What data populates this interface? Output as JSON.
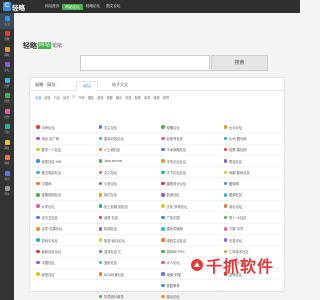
{
  "topbar": {
    "logo_mark": "C",
    "logo_text": "轻略",
    "nav": [
      {
        "label": "网址首页",
        "active": false
      },
      {
        "label": "网站论坛",
        "active": true
      },
      {
        "label": "轻略论坛",
        "active": false
      },
      {
        "label": "图文论坛",
        "active": false
      }
    ]
  },
  "sidebar": {
    "items": [
      {
        "label": "主页",
        "color": "#3a8ee6"
      },
      {
        "label": "轻略",
        "color": "#e23b3b"
      },
      {
        "label": "网站",
        "color": "#e29a25"
      },
      {
        "label": "论坛",
        "color": "#8b5cd6"
      },
      {
        "label": "社区",
        "color": "#3bb3e2"
      },
      {
        "label": "搜索",
        "color": "#4caf50"
      },
      {
        "label": "社交",
        "color": "#e25fa0"
      },
      {
        "label": "导航",
        "color": "#25b39a"
      },
      {
        "label": "网址",
        "color": "#e2c625"
      },
      {
        "label": "博客",
        "color": "#ee7a2d"
      },
      {
        "label": "资讯",
        "color": "#5a7ae2"
      },
      {
        "label": "登录",
        "color": "#9a9a9a"
      }
    ]
  },
  "brand": {
    "main": "轻略",
    "badge": "网站",
    "sub": "论坛"
  },
  "search": {
    "button": "搜索",
    "placeholder": ""
  },
  "panel": {
    "prefix": "轻略 · 网址 ·",
    "tabs": [
      {
        "label": "论坛",
        "active": true
      },
      {
        "label": "帖子大全",
        "active": false
      }
    ],
    "categories": [
      {
        "label": "全部",
        "active": true
      },
      {
        "label": "综合",
        "active": false
      },
      {
        "label": "行业",
        "active": false
      },
      {
        "label": "地方",
        "active": false
      },
      {
        "label": "IT",
        "active": false
      },
      {
        "label": "汽车",
        "active": false
      },
      {
        "label": "摄影",
        "active": false
      },
      {
        "label": "游戏",
        "active": false
      },
      {
        "label": "母婴",
        "active": false
      },
      {
        "label": "娱乐",
        "active": false
      },
      {
        "label": "情感",
        "active": false
      },
      {
        "label": "影视",
        "active": false
      },
      {
        "label": "军事",
        "active": false
      },
      {
        "label": "旅游",
        "active": false
      },
      {
        "label": "体育",
        "active": false
      }
    ],
    "items": [
      {
        "label": "中声论坛",
        "color": "#e23b3b"
      },
      {
        "label": "汉主论坛",
        "color": "#3a8ee6"
      },
      {
        "label": "轻略论坛",
        "color": "#4caf50"
      },
      {
        "label": "大众论坛",
        "color": "#e29a25"
      },
      {
        "label": "电台·杂广网",
        "color": "#8b5cd6"
      },
      {
        "label": "星际问答论坛",
        "color": "#3bb3e2"
      },
      {
        "label": "百家号社区",
        "color": "#e25fa0"
      },
      {
        "label": "片司·藏马网",
        "color": "#25b39a"
      },
      {
        "label": "数学一人社区",
        "color": "#e2c625"
      },
      {
        "label": "小土城社区",
        "color": "#ee7a2d"
      },
      {
        "label": "千木网络社区",
        "color": "#5a7ae2"
      },
      {
        "label": "轻策·霜社网",
        "color": "#e23b3b"
      },
      {
        "label": "家居社区·436",
        "color": "#3a8ee6"
      },
      {
        "label": "Java.sincms",
        "color": "#4caf50"
      },
      {
        "label": "中华论坛社区",
        "color": "#e29a25"
      },
      {
        "label": "秀名社区",
        "color": "#8b5cd6"
      },
      {
        "label": "爱汉电影社区",
        "color": "#3bb3e2"
      },
      {
        "label": "文心论坛",
        "color": "#e25fa0"
      },
      {
        "label": "天下论坛社区",
        "color": "#25b39a"
      },
      {
        "label": "电脑·数码社区",
        "color": "#e2c625"
      },
      {
        "label": "中国网",
        "color": "#ee7a2d"
      },
      {
        "label": "小说论坛",
        "color": "#5a7ae2"
      },
      {
        "label": "建筑设计论坛",
        "color": "#e23b3b"
      },
      {
        "label": "图源网",
        "color": "#3a8ee6"
      },
      {
        "label": "金鹰回网社区",
        "color": "#4caf50"
      },
      {
        "label": "拾忆社区",
        "color": "#e29a25"
      },
      {
        "label": "新浪社区",
        "color": "#8b5cd6"
      },
      {
        "label": "图源社区",
        "color": "#3bb3e2"
      },
      {
        "label": "大学论坛",
        "color": "#e25fa0"
      },
      {
        "label": "化工机械·图社区",
        "color": "#25b39a"
      },
      {
        "label": "文化·学地论坛",
        "color": "#e2c625"
      },
      {
        "label": "羽毛论坛",
        "color": "#ee7a2d"
      },
      {
        "label": "论中文社区",
        "color": "#5a7ae2"
      },
      {
        "label": "读書·社区",
        "color": "#e23b3b"
      },
      {
        "label": "广告中国",
        "color": "#3a8ee6"
      },
      {
        "label": "同人·小社区",
        "color": "#4caf50"
      },
      {
        "label": "论学·在建论坛",
        "color": "#e29a25"
      },
      {
        "label": "机械社区",
        "color": "#8b5cd6"
      },
      {
        "label": "重庆同城网",
        "color": "#3bb3e2"
      },
      {
        "label": "下载·中学",
        "color": "#e25fa0"
      },
      {
        "label": "游戏中论坛",
        "color": "#25b39a"
      },
      {
        "label": "旅游·经社论坛",
        "color": "#e2c625"
      },
      {
        "label": "绿色生活社区",
        "color": "#ee7a2d"
      },
      {
        "label": "天涯论坛",
        "color": "#5a7ae2"
      },
      {
        "label": "最新社区论坛",
        "color": "#e23b3b"
      },
      {
        "label": "游戏社区·汇",
        "color": "#3a8ee6"
      },
      {
        "label": "游戏BETRO·",
        "color": "#4caf50"
      },
      {
        "label": "工商技术社区",
        "color": "#e29a25"
      },
      {
        "label": "中国社区",
        "color": "#8b5cd6"
      },
      {
        "label": "宝妈社区",
        "color": "#3bb3e2"
      },
      {
        "label": "大人论坛",
        "color": "#e25fa0"
      },
      {
        "label": "东北·东北社区",
        "color": "#25b39a"
      },
      {
        "label": "经营社区",
        "color": "#e2c625"
      },
      {
        "label": "NGA玩家社区",
        "color": "#ee7a2d"
      },
      {
        "label": "电梯·中国",
        "color": "#5a7ae2"
      },
      {
        "label": "游戏社区",
        "color": "#e23b3b"
      },
      {
        "label": "",
        "color": "#ffffff"
      },
      {
        "label": "",
        "color": "#ffffff"
      },
      {
        "label": "家庭教育",
        "color": "#3a8ee6"
      },
      {
        "label": "",
        "color": "#ffffff"
      },
      {
        "label": "",
        "color": "#ffffff"
      },
      {
        "label": "学员统计服务",
        "color": "#4caf50"
      },
      {
        "label": "菜谷论坛",
        "color": "#e29a25"
      },
      {
        "label": "",
        "color": "#ffffff"
      }
    ]
  },
  "watermark": {
    "text": "千抓软件"
  }
}
